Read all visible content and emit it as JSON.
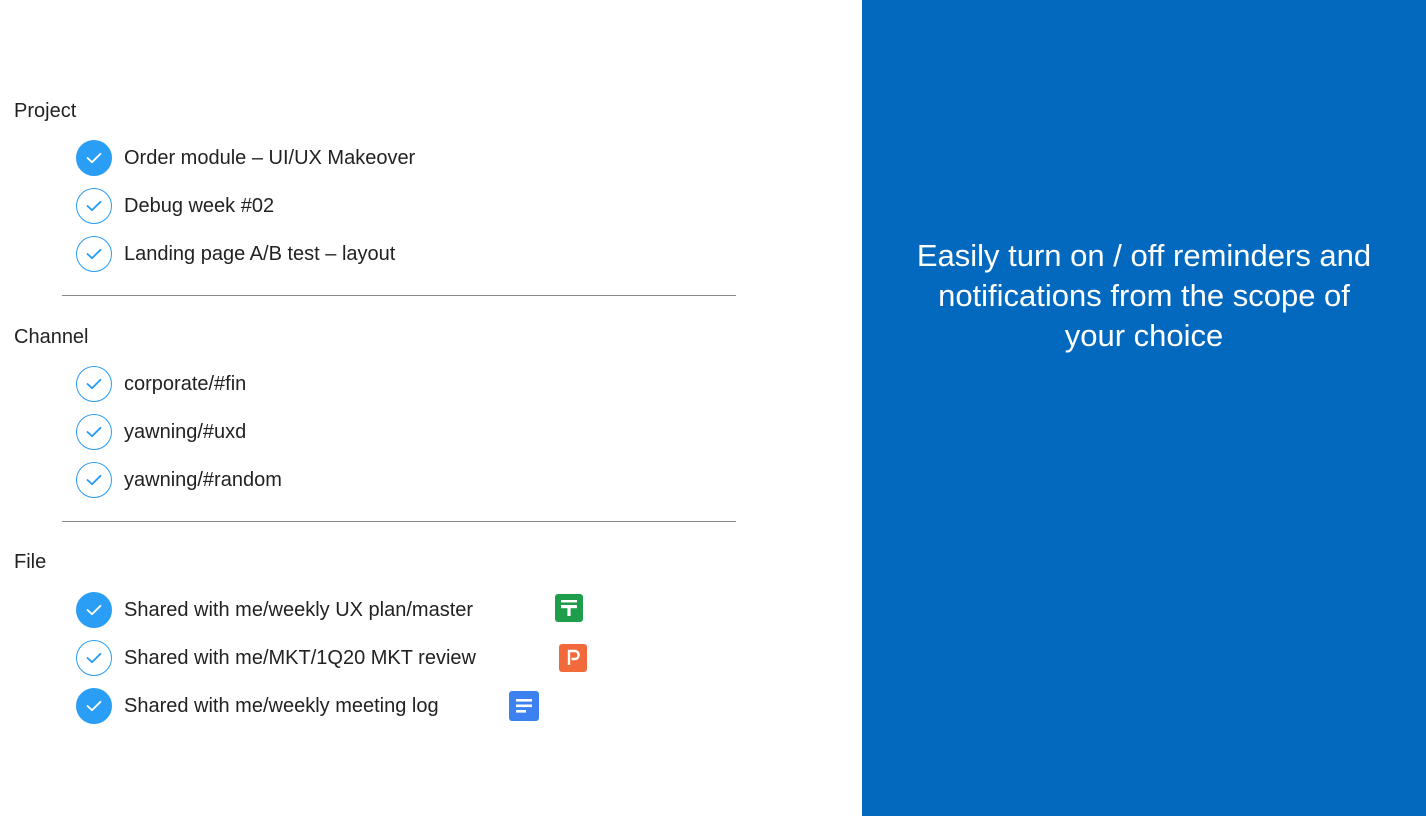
{
  "project": {
    "title": "Project",
    "items": [
      {
        "label": "Order module – UI/UX Makeover",
        "checked": true
      },
      {
        "label": "Debug week #02",
        "checked": false
      },
      {
        "label": "Landing page A/B test – layout",
        "checked": false
      }
    ]
  },
  "channel": {
    "title": "Channel",
    "items": [
      {
        "label": "corporate/#fin",
        "checked": false
      },
      {
        "label": "yawning/#uxd",
        "checked": false
      },
      {
        "label": "yawning/#random",
        "checked": false
      }
    ]
  },
  "file": {
    "title": "File",
    "items": [
      {
        "label": "Shared with me/weekly UX plan/master",
        "checked": true,
        "icon": "sheets-icon"
      },
      {
        "label": "Shared with me/MKT/1Q20 MKT review",
        "checked": false,
        "icon": "slides-icon"
      },
      {
        "label": "Shared with me/weekly meeting log",
        "checked": true,
        "icon": "docs-icon"
      }
    ]
  },
  "promo": {
    "text": "Easily turn on / off reminders and notifications from the scope of your choice"
  },
  "colors": {
    "accent": "#2a9df4",
    "panel": "#0369bf",
    "sheets": "#1e9e4a",
    "slides": "#f26a3b",
    "docs": "#3b82f0"
  }
}
